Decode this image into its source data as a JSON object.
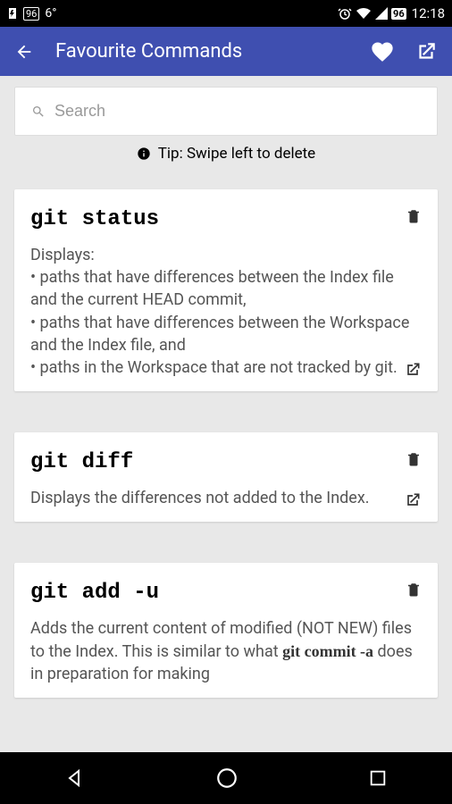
{
  "statusBar": {
    "temp": "6°",
    "batteryPct": "96",
    "time": "12:18"
  },
  "appBar": {
    "title": "Favourite Commands"
  },
  "search": {
    "placeholder": "Search"
  },
  "tip": "Tip: Swipe left to delete",
  "cards": [
    {
      "title": "git status",
      "description": "Displays:\n• paths that have differences between the Index file and the current HEAD commit,\n• paths that have differences between the Workspace and the Index file, and\n• paths in the Workspace that are not tracked by git."
    },
    {
      "title": "git diff",
      "description": "Displays the differences not added to the Index."
    },
    {
      "title": "git add -u",
      "descriptionPrefix": "Adds the current content of modified (NOT NEW) files to the Index. This is similar to what ",
      "descriptionCode": "git commit -a",
      "descriptionSuffix": " does in preparation for making"
    }
  ]
}
